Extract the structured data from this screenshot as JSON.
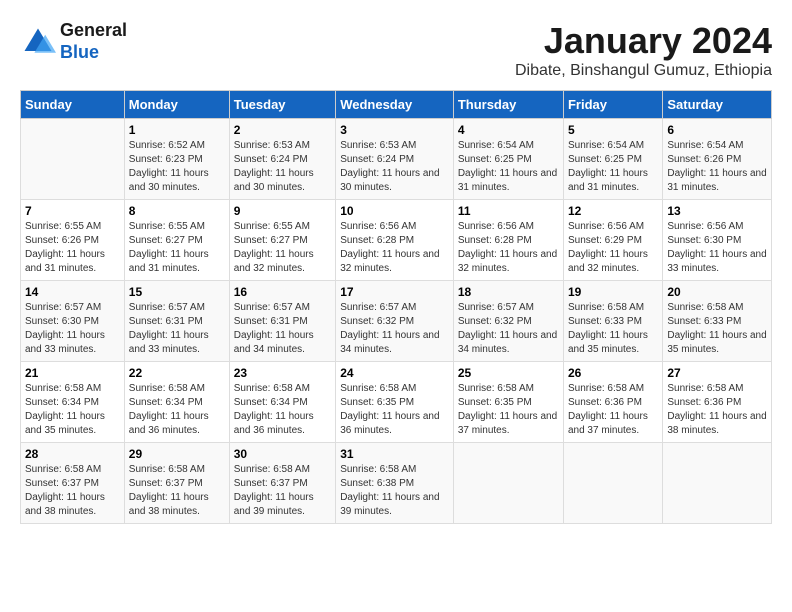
{
  "logo": {
    "line1": "General",
    "line2": "Blue"
  },
  "title": "January 2024",
  "subtitle": "Dibate, Binshangul Gumuz, Ethiopia",
  "days_of_week": [
    "Sunday",
    "Monday",
    "Tuesday",
    "Wednesday",
    "Thursday",
    "Friday",
    "Saturday"
  ],
  "weeks": [
    [
      {
        "day": "",
        "sunrise": "",
        "sunset": "",
        "daylight": ""
      },
      {
        "day": "1",
        "sunrise": "6:52 AM",
        "sunset": "6:23 PM",
        "daylight": "11 hours and 30 minutes."
      },
      {
        "day": "2",
        "sunrise": "6:53 AM",
        "sunset": "6:24 PM",
        "daylight": "11 hours and 30 minutes."
      },
      {
        "day": "3",
        "sunrise": "6:53 AM",
        "sunset": "6:24 PM",
        "daylight": "11 hours and 30 minutes."
      },
      {
        "day": "4",
        "sunrise": "6:54 AM",
        "sunset": "6:25 PM",
        "daylight": "11 hours and 31 minutes."
      },
      {
        "day": "5",
        "sunrise": "6:54 AM",
        "sunset": "6:25 PM",
        "daylight": "11 hours and 31 minutes."
      },
      {
        "day": "6",
        "sunrise": "6:54 AM",
        "sunset": "6:26 PM",
        "daylight": "11 hours and 31 minutes."
      }
    ],
    [
      {
        "day": "7",
        "sunrise": "6:55 AM",
        "sunset": "6:26 PM",
        "daylight": "11 hours and 31 minutes."
      },
      {
        "day": "8",
        "sunrise": "6:55 AM",
        "sunset": "6:27 PM",
        "daylight": "11 hours and 31 minutes."
      },
      {
        "day": "9",
        "sunrise": "6:55 AM",
        "sunset": "6:27 PM",
        "daylight": "11 hours and 32 minutes."
      },
      {
        "day": "10",
        "sunrise": "6:56 AM",
        "sunset": "6:28 PM",
        "daylight": "11 hours and 32 minutes."
      },
      {
        "day": "11",
        "sunrise": "6:56 AM",
        "sunset": "6:28 PM",
        "daylight": "11 hours and 32 minutes."
      },
      {
        "day": "12",
        "sunrise": "6:56 AM",
        "sunset": "6:29 PM",
        "daylight": "11 hours and 32 minutes."
      },
      {
        "day": "13",
        "sunrise": "6:56 AM",
        "sunset": "6:30 PM",
        "daylight": "11 hours and 33 minutes."
      }
    ],
    [
      {
        "day": "14",
        "sunrise": "6:57 AM",
        "sunset": "6:30 PM",
        "daylight": "11 hours and 33 minutes."
      },
      {
        "day": "15",
        "sunrise": "6:57 AM",
        "sunset": "6:31 PM",
        "daylight": "11 hours and 33 minutes."
      },
      {
        "day": "16",
        "sunrise": "6:57 AM",
        "sunset": "6:31 PM",
        "daylight": "11 hours and 34 minutes."
      },
      {
        "day": "17",
        "sunrise": "6:57 AM",
        "sunset": "6:32 PM",
        "daylight": "11 hours and 34 minutes."
      },
      {
        "day": "18",
        "sunrise": "6:57 AM",
        "sunset": "6:32 PM",
        "daylight": "11 hours and 34 minutes."
      },
      {
        "day": "19",
        "sunrise": "6:58 AM",
        "sunset": "6:33 PM",
        "daylight": "11 hours and 35 minutes."
      },
      {
        "day": "20",
        "sunrise": "6:58 AM",
        "sunset": "6:33 PM",
        "daylight": "11 hours and 35 minutes."
      }
    ],
    [
      {
        "day": "21",
        "sunrise": "6:58 AM",
        "sunset": "6:34 PM",
        "daylight": "11 hours and 35 minutes."
      },
      {
        "day": "22",
        "sunrise": "6:58 AM",
        "sunset": "6:34 PM",
        "daylight": "11 hours and 36 minutes."
      },
      {
        "day": "23",
        "sunrise": "6:58 AM",
        "sunset": "6:34 PM",
        "daylight": "11 hours and 36 minutes."
      },
      {
        "day": "24",
        "sunrise": "6:58 AM",
        "sunset": "6:35 PM",
        "daylight": "11 hours and 36 minutes."
      },
      {
        "day": "25",
        "sunrise": "6:58 AM",
        "sunset": "6:35 PM",
        "daylight": "11 hours and 37 minutes."
      },
      {
        "day": "26",
        "sunrise": "6:58 AM",
        "sunset": "6:36 PM",
        "daylight": "11 hours and 37 minutes."
      },
      {
        "day": "27",
        "sunrise": "6:58 AM",
        "sunset": "6:36 PM",
        "daylight": "11 hours and 38 minutes."
      }
    ],
    [
      {
        "day": "28",
        "sunrise": "6:58 AM",
        "sunset": "6:37 PM",
        "daylight": "11 hours and 38 minutes."
      },
      {
        "day": "29",
        "sunrise": "6:58 AM",
        "sunset": "6:37 PM",
        "daylight": "11 hours and 38 minutes."
      },
      {
        "day": "30",
        "sunrise": "6:58 AM",
        "sunset": "6:37 PM",
        "daylight": "11 hours and 39 minutes."
      },
      {
        "day": "31",
        "sunrise": "6:58 AM",
        "sunset": "6:38 PM",
        "daylight": "11 hours and 39 minutes."
      },
      {
        "day": "",
        "sunrise": "",
        "sunset": "",
        "daylight": ""
      },
      {
        "day": "",
        "sunrise": "",
        "sunset": "",
        "daylight": ""
      },
      {
        "day": "",
        "sunrise": "",
        "sunset": "",
        "daylight": ""
      }
    ]
  ]
}
